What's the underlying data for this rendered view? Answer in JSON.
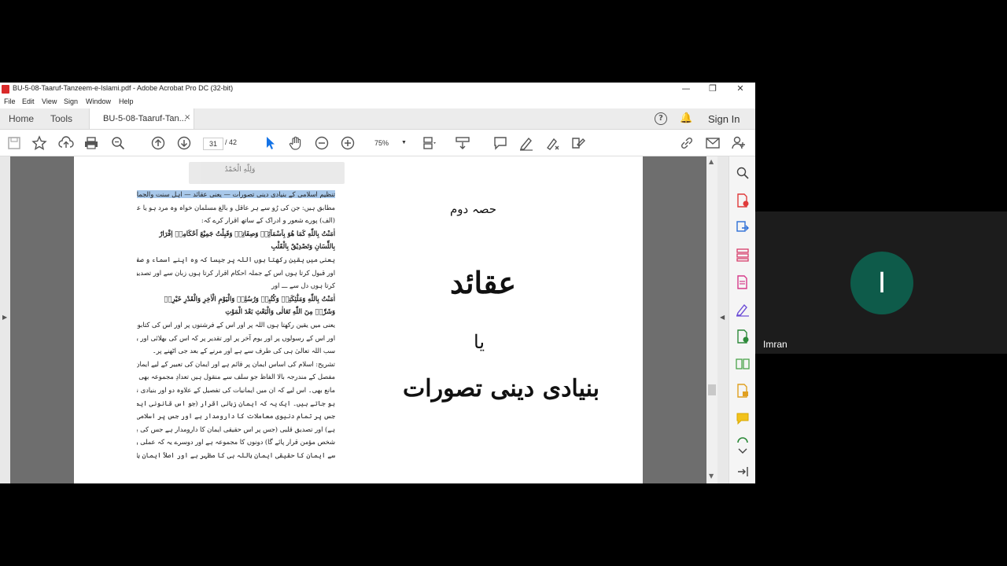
{
  "window": {
    "title": "BU-5-08-Taaruf-Tanzeem-e-Islami.pdf - Adobe Acrobat Pro DC (32-bit)",
    "minimize": "—",
    "restore": "❐",
    "close": "✕"
  },
  "menu": [
    "File",
    "Edit",
    "View",
    "Sign",
    "Window",
    "Help"
  ],
  "nav": {
    "home": "Home",
    "tools": "Tools",
    "doc_tab": "BU-5-08-Taaruf-Tan...",
    "doc_tab_close": "×",
    "help": "?",
    "sign_in": "Sign In"
  },
  "toolbar": {
    "page_current": "31",
    "page_total": "/ 42",
    "zoom": "75%"
  },
  "page_left": {
    "floating_header": "وَلِلّٰهِ الْحَمْدُ",
    "lines": [
      "تنظیم اسلامی کے بنیادی دینی تصورات — یعنی عقائد — اہل سنت والجماعت کے",
      "مطابق ہیں: جن کی رُو سے ہر عاقل و بالغ مسلمان خواہ وہ مرد ہو یا عورت پر لازم ہے کہ وہ:",
      "(الف) پورے شعور و ادراک کے ساتھ اقرار کرے کہ:",
      "اٰمَنْتُ بِاللّٰهِ کَمَا هُوَ بِاَسْمَآئِهٖ وَصِفَاتِهٖ وَقَبِلْتُ جَمِیْعَ اَحْکَامِهٖ اِقْرَارٌ",
      "بِاللِّسَانِ وَتَصْدِیْقٌ بِالْقَلْبِ",
      "یعنی میں یقین رکھتا ہوں اللہ پر جیسا کہ وہ اپنے اسماء و صفات سے ظاہر ہے",
      "اور قبول کرتا ہوں اس کے جملہ احکام اقرار کرتا ہوں زبان سے اور تصدیق",
      "کرتا ہوں دل سے ـــ اور",
      "اٰمَنْتُ بِاللّٰهِ وَمَلٰٓئِکَتِهٖ وَکُتُبِهٖ وَرُسُلِهٖ وَالْیَوْمِ الْاٰخِرِ وَالْقَدْرِ خَیْرِهٖ",
      "وَشَرِّهٖ مِنَ اللّٰهِ تَعَالٰی وَالْبَعْثِ بَعْدَ الْمَوْتِ",
      "یعنی میں یقین رکھتا ہوں اللہ پر اور اس کے فرشتوں پر اور اس کی کتابوں پر",
      "اور اس کے رسولوں پر اور یوم آخر پر اور تقدیر پر کہ اس کی بھلائی اور برائی",
      "سب اللہ تعالیٰ ہی کی طرف سے ہے اور مرنے کے بعد جی اٹھنے پر۔",
      "تشریح: اسلام کی اساس ایمان پر قائم ہے اور ایمان کی تعبیر کے لیے ایمان مجمل اور ایمان",
      "مفصل کے مندرجہ بالا الفاظ جو سلف سے منقول ہیں تعدادِ مجموعہ بھی ہیں اور نہایت جامع و",
      "مانع بھی۔ اس لیے کہ ان میں ایمانیات کی تفصیل کے علاوہ دو اور بنیادی نکتے بھی واضح",
      "ہو جاتے ہیں۔ ایک یہ کہ ایمان زبانی اقرار (جو اس قانونی ایمان یعنی اسلام کا رکن اولین ہے",
      "جس پر تمام دنیوی معاملات کا دارومدار ہے اور جس پر اسلامی ہیئت اجتماعی کی بنیاد قائم ہوتی",
      "ہے) اور تصدیق قلبی (جس پر اس حقیقی ایمان کا دارومدار ہے جس کی بنا پر آخرت میں کوئی",
      "شخص مؤمن قرار پائے گا) دونوں کا مجموعہ ہے اور دوسرے یہ کہ عملی و نظری اور اصولی اعتبار",
      "سے ایمان کا حقیقی ایمان باللہ ہی کا مظہر ہے اور اصلاً ایمان باللہ ہی کے فروع ہیں۔"
    ]
  },
  "page_right": {
    "section": "حصہ دوم",
    "title": "عقائد",
    "or": "یا",
    "subtitle": "بنیادی دینی تصورات"
  },
  "participant": {
    "initial": "I",
    "name": "Imran",
    "avatar_color": "#0e5b4a"
  }
}
